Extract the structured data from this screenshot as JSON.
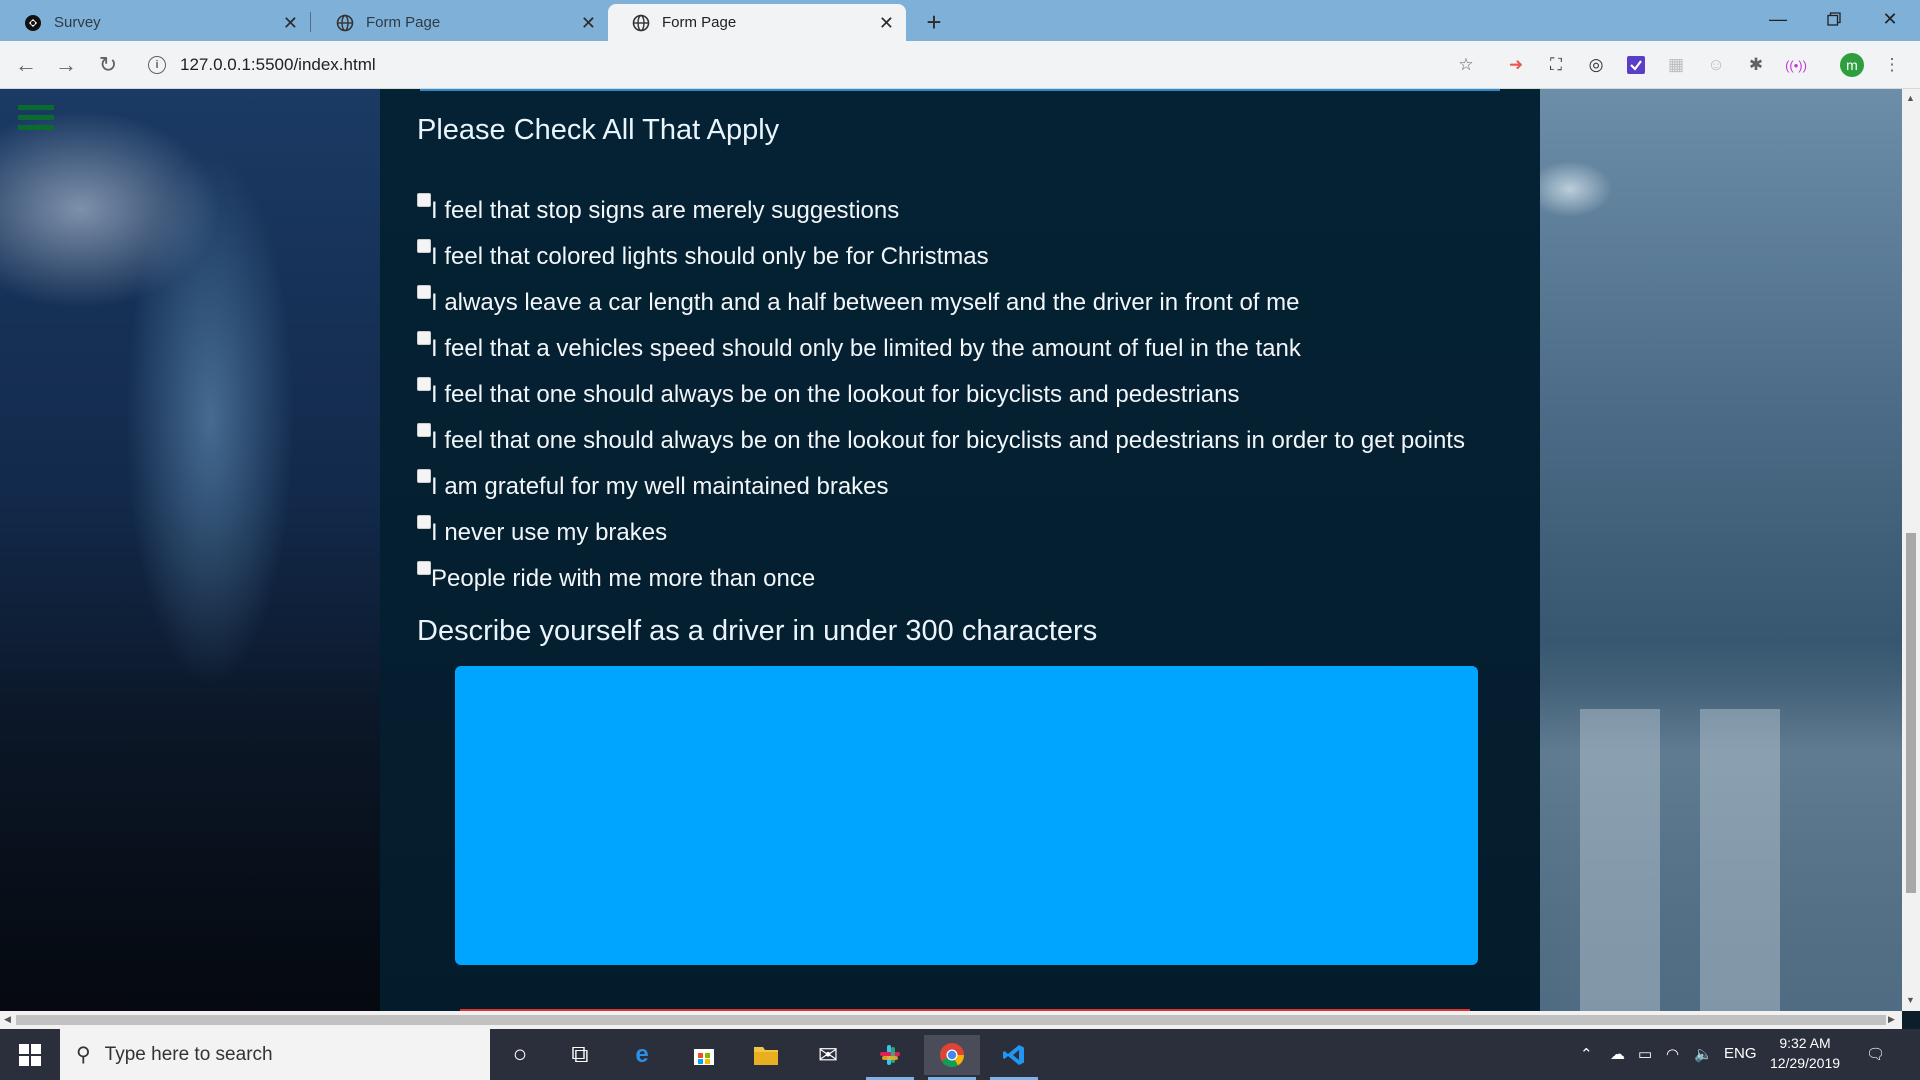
{
  "browser": {
    "tabs": [
      {
        "title": "Survey",
        "active": false
      },
      {
        "title": "Form Page",
        "active": false
      },
      {
        "title": "Form Page",
        "active": true
      }
    ],
    "url": "127.0.0.1:5500/index.html",
    "profile_initial": "m"
  },
  "form": {
    "checkbox_heading": "Please Check All That Apply",
    "options": [
      "I feel that stop signs are merely suggestions",
      "I feel that colored lights should only be for Christmas",
      "I always leave a car length and a half between myself and the driver in front of me",
      "I feel that a vehicles speed should only be limited by the amount of fuel in the tank",
      "I feel that one should always be on the lookout for bicyclists and pedestrians",
      "I feel that one should always be on the lookout for bicyclists and pedestrians in order to get points",
      "I am grateful for my well maintained brakes",
      "I never use my brakes",
      "People ride with me more than once"
    ],
    "describe_heading": "Describe yourself as a driver in under 300 characters",
    "textarea_value": "",
    "textarea_color": "#00a5ff"
  },
  "taskbar": {
    "search_placeholder": "Type here to search",
    "language": "ENG",
    "time": "9:32 AM",
    "date": "12/29/2019"
  },
  "colors": {
    "tab_strip": "#7fb0d8",
    "panel_bg": "#042234",
    "hamburger": "#0a6b2e"
  }
}
